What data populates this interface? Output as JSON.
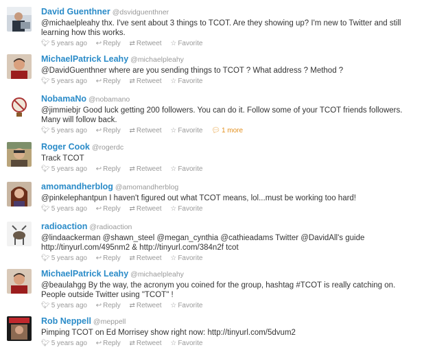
{
  "icons": {
    "bird": "twitter-bird-icon",
    "reply": "reply-icon",
    "retweet": "retweet-icon",
    "favorite": "star-icon",
    "conversation": "speech-bubble-icon"
  },
  "colors": {
    "name": "#2a8bc8",
    "meta": "#999999",
    "text": "#333333",
    "conversation": "#e38f1b"
  },
  "tweets": [
    {
      "name": "David Guenthner",
      "handle": "@dsvidguenthner",
      "text": "@michaelpleahy thx. I've sent about 3 things to TCOT. Are they showing up? I'm new to Twitter and still learning how this works.",
      "time": "5 years ago",
      "reply": "Reply",
      "retweet": "Retweet",
      "favorite": "Favorite"
    },
    {
      "name": "MichaelPatrick Leahy",
      "handle": "@michaelpleahy",
      "text": "@DavidGuenthner where are you sending things to TCOT ? What address ? Method ?",
      "time": "5 years ago",
      "reply": "Reply",
      "retweet": "Retweet",
      "favorite": "Favorite"
    },
    {
      "name": "NobamaNo",
      "handle": "@nobamano",
      "text": "@jimmiebjr Good luck getting 200 followers. You can do it. Follow some of your TCOT friends followers. Many will follow back.",
      "time": "5 years ago",
      "reply": "Reply",
      "retweet": "Retweet",
      "favorite": "Favorite",
      "more": "1 more"
    },
    {
      "name": "Roger Cook",
      "handle": "@rogerdc",
      "text": "Track TCOT",
      "time": "5 years ago",
      "reply": "Reply",
      "retweet": "Retweet",
      "favorite": "Favorite"
    },
    {
      "name": "amomandherblog",
      "handle": "@amomandherblog",
      "text": "@pinkelephantpun I haven't figured out what TCOT means, lol...must be working too hard!",
      "time": "5 years ago",
      "reply": "Reply",
      "retweet": "Retweet",
      "favorite": "Favorite"
    },
    {
      "name": "radioaction",
      "handle": "@radioaction",
      "text": "@lindaackerman @shawn_steel @megan_cynthia @cathieadams Twitter @DavidAll's guide http://tinyurl.com/495nm2 & http://tinyurl.com/384n2f tcot",
      "time": "5 years ago",
      "reply": "Reply",
      "retweet": "Retweet",
      "favorite": "Favorite"
    },
    {
      "name": "MichaelPatrick Leahy",
      "handle": "@michaelpleahy",
      "text": "@beaulahgg By the way, the acronym you coined for the group, hashtag #TCOT is really catching on. People outside Twitter using \"TCOT\" !",
      "time": "5 years ago",
      "reply": "Reply",
      "retweet": "Retweet",
      "favorite": "Favorite"
    },
    {
      "name": "Rob Neppell",
      "handle": "@meppell",
      "text": "Pimping TCOT on Ed Morrisey show right now: http://tinyurl.com/5dvum2",
      "time": "5 years ago",
      "reply": "Reply",
      "retweet": "Retweet",
      "favorite": "Favorite"
    }
  ]
}
